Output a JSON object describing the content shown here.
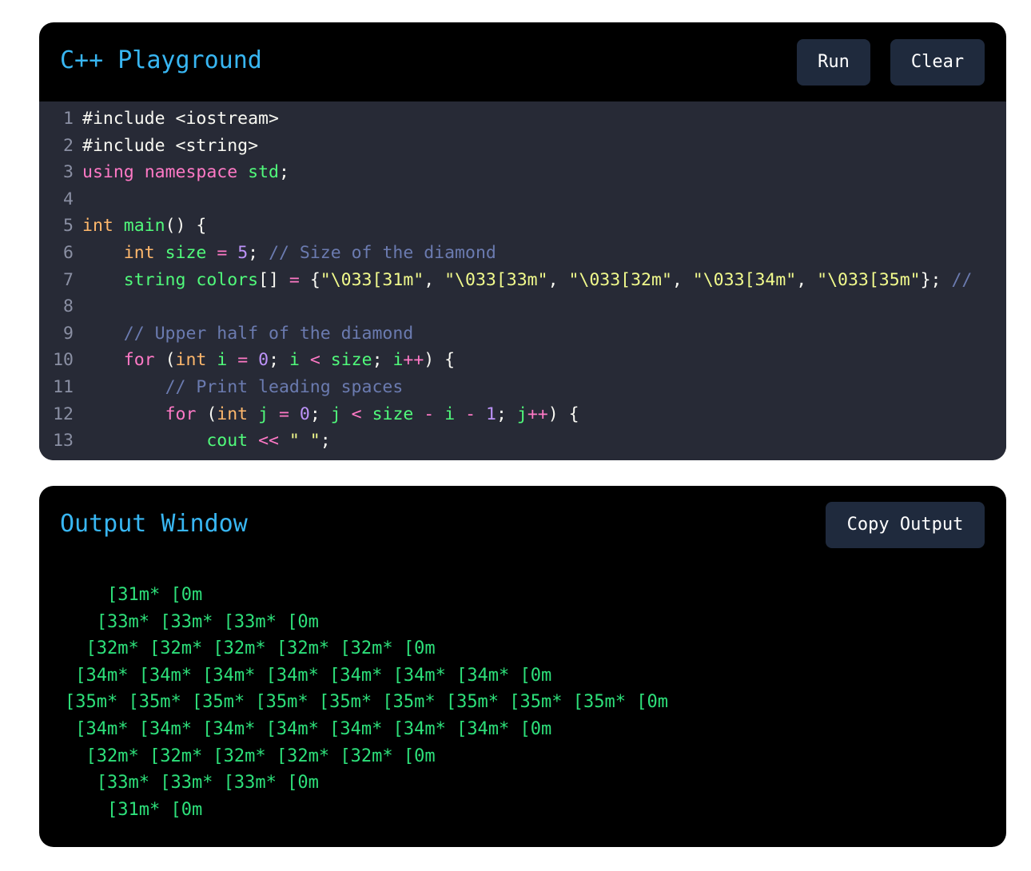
{
  "editor": {
    "title": "C++ Playground",
    "run_label": "Run",
    "clear_label": "Clear",
    "lines": [
      {
        "n": "1",
        "t": [
          [
            "pl",
            "#include <iostream>"
          ]
        ]
      },
      {
        "n": "2",
        "t": [
          [
            "pl",
            "#include <string>"
          ]
        ]
      },
      {
        "n": "3",
        "t": [
          [
            "kw",
            "using"
          ],
          [
            "pl",
            " "
          ],
          [
            "kw",
            "namespace"
          ],
          [
            "pl",
            " "
          ],
          [
            "fn",
            "std"
          ],
          [
            "pl",
            ";"
          ]
        ]
      },
      {
        "n": "4",
        "t": []
      },
      {
        "n": "5",
        "t": [
          [
            "ty",
            "int"
          ],
          [
            "pl",
            " "
          ],
          [
            "fn",
            "main"
          ],
          [
            "pl",
            "() {"
          ]
        ]
      },
      {
        "n": "6",
        "t": [
          [
            "pl",
            "    "
          ],
          [
            "ty",
            "int"
          ],
          [
            "pl",
            " "
          ],
          [
            "fn",
            "size"
          ],
          [
            "pl",
            " "
          ],
          [
            "kw",
            "="
          ],
          [
            "pl",
            " "
          ],
          [
            "num",
            "5"
          ],
          [
            "pl",
            "; "
          ],
          [
            "cm",
            "// Size of the diamond"
          ]
        ]
      },
      {
        "n": "7",
        "t": [
          [
            "pl",
            "    "
          ],
          [
            "fn",
            "string"
          ],
          [
            "pl",
            " "
          ],
          [
            "fn",
            "colors"
          ],
          [
            "pl",
            "[] "
          ],
          [
            "kw",
            "="
          ],
          [
            "pl",
            " {"
          ],
          [
            "str",
            "\"\\033[31m\""
          ],
          [
            "pl",
            ", "
          ],
          [
            "str",
            "\"\\033[33m\""
          ],
          [
            "pl",
            ", "
          ],
          [
            "str",
            "\"\\033[32m\""
          ],
          [
            "pl",
            ", "
          ],
          [
            "str",
            "\"\\033[34m\""
          ],
          [
            "pl",
            ", "
          ],
          [
            "str",
            "\"\\033[35m\""
          ],
          [
            "pl",
            "}; "
          ],
          [
            "cm",
            "//"
          ]
        ]
      },
      {
        "n": "8",
        "t": []
      },
      {
        "n": "9",
        "t": [
          [
            "pl",
            "    "
          ],
          [
            "cm",
            "// Upper half of the diamond"
          ]
        ]
      },
      {
        "n": "10",
        "t": [
          [
            "pl",
            "    "
          ],
          [
            "kw",
            "for"
          ],
          [
            "pl",
            " ("
          ],
          [
            "ty",
            "int"
          ],
          [
            "pl",
            " "
          ],
          [
            "fn",
            "i"
          ],
          [
            "pl",
            " "
          ],
          [
            "kw",
            "="
          ],
          [
            "pl",
            " "
          ],
          [
            "num",
            "0"
          ],
          [
            "pl",
            "; "
          ],
          [
            "fn",
            "i"
          ],
          [
            "pl",
            " "
          ],
          [
            "kw",
            "<"
          ],
          [
            "pl",
            " "
          ],
          [
            "fn",
            "size"
          ],
          [
            "pl",
            "; "
          ],
          [
            "fn",
            "i"
          ],
          [
            "kw",
            "++"
          ],
          [
            "pl",
            ") {"
          ]
        ]
      },
      {
        "n": "11",
        "t": [
          [
            "pl",
            "        "
          ],
          [
            "cm",
            "// Print leading spaces"
          ]
        ]
      },
      {
        "n": "12",
        "t": [
          [
            "pl",
            "        "
          ],
          [
            "kw",
            "for"
          ],
          [
            "pl",
            " ("
          ],
          [
            "ty",
            "int"
          ],
          [
            "pl",
            " "
          ],
          [
            "fn",
            "j"
          ],
          [
            "pl",
            " "
          ],
          [
            "kw",
            "="
          ],
          [
            "pl",
            " "
          ],
          [
            "num",
            "0"
          ],
          [
            "pl",
            "; "
          ],
          [
            "fn",
            "j"
          ],
          [
            "pl",
            " "
          ],
          [
            "kw",
            "<"
          ],
          [
            "pl",
            " "
          ],
          [
            "fn",
            "size"
          ],
          [
            "pl",
            " "
          ],
          [
            "kw",
            "-"
          ],
          [
            "pl",
            " "
          ],
          [
            "fn",
            "i"
          ],
          [
            "pl",
            " "
          ],
          [
            "kw",
            "-"
          ],
          [
            "pl",
            " "
          ],
          [
            "num",
            "1"
          ],
          [
            "pl",
            "; "
          ],
          [
            "fn",
            "j"
          ],
          [
            "kw",
            "++"
          ],
          [
            "pl",
            ") {"
          ]
        ]
      },
      {
        "n": "13",
        "t": [
          [
            "pl",
            "            "
          ],
          [
            "fn",
            "cout"
          ],
          [
            "pl",
            " "
          ],
          [
            "kw",
            "<<"
          ],
          [
            "pl",
            " "
          ],
          [
            "str",
            "\" \""
          ],
          [
            "pl",
            ";"
          ]
        ]
      }
    ]
  },
  "output": {
    "title": "Output Window",
    "copy_label": "Copy Output",
    "lines": [
      "    [31m* [0m",
      "   [33m* [33m* [33m* [0m",
      "  [32m* [32m* [32m* [32m* [32m* [0m",
      " [34m* [34m* [34m* [34m* [34m* [34m* [34m* [0m",
      "[35m* [35m* [35m* [35m* [35m* [35m* [35m* [35m* [35m* [0m",
      " [34m* [34m* [34m* [34m* [34m* [34m* [34m* [0m",
      "  [32m* [32m* [32m* [32m* [32m* [0m",
      "   [33m* [33m* [33m* [0m",
      "    [31m* [0m"
    ]
  },
  "colors": {
    "title": "#38b6f2",
    "button_bg": "#1f2a3d",
    "editor_bg": "#272a36",
    "output_text": "#2de07a"
  }
}
